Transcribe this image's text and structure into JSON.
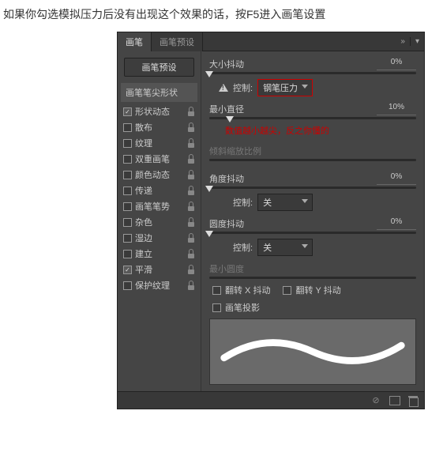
{
  "caption": "如果你勾选模拟压力后没有出现这个效果的话，按F5进入画笔设置",
  "tabs": {
    "active": "画笔",
    "inactive": "画笔预设"
  },
  "preset_btn": "画笔预设",
  "section_header": "画笔笔尖形状",
  "sidebar": [
    {
      "label": "形状动态",
      "checked": true
    },
    {
      "label": "散布",
      "checked": false
    },
    {
      "label": "纹理",
      "checked": false
    },
    {
      "label": "双重画笔",
      "checked": false
    },
    {
      "label": "颜色动态",
      "checked": false
    },
    {
      "label": "传递",
      "checked": false
    },
    {
      "label": "画笔笔势",
      "checked": false
    },
    {
      "label": "杂色",
      "checked": false
    },
    {
      "label": "湿边",
      "checked": false
    },
    {
      "label": "建立",
      "checked": false
    },
    {
      "label": "平滑",
      "checked": true
    },
    {
      "label": "保护纹理",
      "checked": false
    }
  ],
  "sliders": {
    "size_jitter": {
      "label": "大小抖动",
      "value": "0%",
      "pos": 0
    },
    "min_diameter": {
      "label": "最小直径",
      "value": "10%",
      "pos": 10
    },
    "tilt_scale": {
      "label": "倾斜缩放比例",
      "value": "",
      "dim": true
    },
    "angle_jitter": {
      "label": "角度抖动",
      "value": "0%",
      "pos": 0
    },
    "round_jitter": {
      "label": "圆度抖动",
      "value": "0%",
      "pos": 0
    },
    "min_round": {
      "label": "最小圆度",
      "value": "",
      "dim": true
    }
  },
  "controls": {
    "label": "控制:",
    "opt1": "钢笔压力",
    "opt2": "关",
    "opt3": "关"
  },
  "note": "数值越小越尖，反之你懂的",
  "flips": {
    "x": "翻转 X 抖动",
    "y": "翻转 Y 抖动",
    "proj": "画笔投影"
  },
  "chevrons": "» | ▾"
}
